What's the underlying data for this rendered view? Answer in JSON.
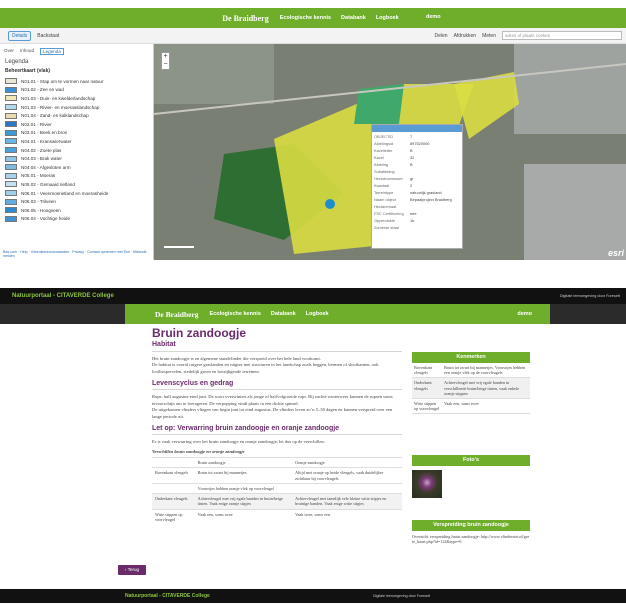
{
  "nav": {
    "brand": "De Braidberg",
    "items": [
      "Ecologische kennis",
      "Databank",
      "Logboek"
    ],
    "user": "demo"
  },
  "toolbar": {
    "details": "Details",
    "backstaat": "Backstaat",
    "right": [
      "Delen",
      "Afdrukken",
      "Meten"
    ],
    "search_placeholder": "adres of plaats zoeken"
  },
  "legend": {
    "tabs": [
      "Over",
      "Inhoud",
      "Legenda"
    ],
    "title": "Legenda",
    "subtitle": "Beheertkaart (vlak)",
    "items": [
      {
        "label": "N01.01 - Stap om te vormen naar natuur",
        "color": "#e9e7d4"
      },
      {
        "label": "N01.02 - Zee en wad",
        "color": "#3b8ed8"
      },
      {
        "label": "N01.03 - Duin- en kwelderlandschap",
        "color": "#f0e6b6"
      },
      {
        "label": "N01.03 - Rivier- en moerasslandschap",
        "color": "#b2d7ef"
      },
      {
        "label": "N01.04 - Zand- en kalklandschap",
        "color": "#e8dbb0"
      },
      {
        "label": "N02.01 - Rivier",
        "color": "#2c78c8"
      },
      {
        "label": "N03.01 - Beek en bron",
        "color": "#3a9ad8"
      },
      {
        "label": "N04.01 - Kranswierwater",
        "color": "#69b6e2"
      },
      {
        "label": "N04.02 - Zoete plas",
        "color": "#4aa2dc"
      },
      {
        "label": "N04.03 - Brak water",
        "color": "#8fc4e6"
      },
      {
        "label": "N04.04 - Afgesloten arm",
        "color": "#7cb9e0"
      },
      {
        "label": "N05.01 - Moeras",
        "color": "#a8d2ee"
      },
      {
        "label": "N05.02 - Gemaaid rietland",
        "color": "#c4e0f2"
      },
      {
        "label": "N06.01 - Veenmosrietland en moerasheide",
        "color": "#9ecfe9"
      },
      {
        "label": "N06.03 - Trilveen",
        "color": "#5fb0e0"
      },
      {
        "label": "N06.05 - Hoogveen",
        "color": "#2b8bcf"
      },
      {
        "label": "N06.04 - Vochtige heide",
        "color": "#3f92d2"
      }
    ],
    "footer": "Bas.com · Help · Gebruikersvoorwaarden · Privacy · Contact opnemen met Esri · Misbruik melden"
  },
  "map": {
    "popup": [
      [
        "OBJECTID",
        "7"
      ],
      [
        "Afdelingsid",
        "897520000"
      ],
      [
        "Kavelletter",
        "B"
      ],
      [
        "Kavel",
        "32"
      ],
      [
        "Afdeling",
        "B"
      ],
      [
        "Subafdeling",
        ""
      ],
      [
        "Hectoboomsoort",
        "gr"
      ],
      [
        "Kwartaal",
        "2"
      ],
      [
        "Terreintype",
        "natuurlijk grasland"
      ],
      [
        "Naam object",
        "Bepaalproject Braidberg"
      ],
      [
        "Hectaremaat",
        ""
      ],
      [
        "FSC Certificering",
        "nee"
      ],
      [
        "Oppervlakte",
        "1b"
      ],
      [
        "Zomerse staat",
        ""
      ]
    ],
    "attribution": "esri"
  },
  "page": {
    "header_title": "Natuurportaal - CITAVERDE College",
    "header_right": "Digitale leeromgeving door Foresett",
    "title": "Bruin zandoogje",
    "h_habitat": "Habitat",
    "habitat_1": "Het bruin zandoogje is en algemene standvlinder die verspreid over het hele land voorkomt.",
    "habitat_2": "De habitat is vooral ruigere graslanden en ruigtes met structuren in het landschap zoals heggen, bermen of slootkanten, ook loofbospercelen, stedelijk groen en bosrijkgende terreinen.",
    "h_cycle": "Levenscyclus en gedrag",
    "cycle_1": "Rups: half augustus-eind juni. De soort overwintert als jonge of halfvolgroeide rups. Bij zachte winterweer kunnen de rupsen soms tevoorschijn om te foerageren. De verpopping vindt plaats in een dichte spinsel.",
    "cycle_2": "De uitgekomen vlinders vliegen van begin juni tot eind augustus. De vlinders leven zo’n 5–30 dagen en kunnen verspreid over een lange periode uit.",
    "h_confusion": "Let op: Verwarring bruin zandoogje en oranje zandoogje",
    "confusion_1": "Er is vaak verwarring over het bruin zandoogje en oranje zandoogje, let dus op de verschillen.",
    "confusion_sub": "Verschillen bruin zandoogje en oranje zandoogje",
    "table_head": [
      "",
      "Bruin zandoogje",
      "Oranje zandoogje"
    ],
    "table_rows": [
      [
        "Bovenkant vleugels",
        "Bruin tot zwart bij mannetjes.",
        "Altijd met oranje op beide vleugels, vaak duidelijker zichtbaar bij voorvleugels"
      ],
      [
        "",
        "Vrouwtjes hebben oranje vlek op voorvleugel",
        ""
      ],
      [
        "Onderkant vleugels",
        "Achtervleugel met vrij egale banden in bruin/beige tinten. Vaak enige oranje stipjes",
        "Achtervleugel met tamelijk vele kleine witte stipjes en bruinige banden. Vaak enige witte stipjes"
      ],
      [
        "Witte stippen op voorvleugel",
        "Vaak een, soms twee",
        "Vaak twee, soms een"
      ]
    ],
    "side_kenmerken": "Kenmerken",
    "kenmerken_rows": [
      [
        "Bovenkant vleugels",
        "Bruin tot zwart bij mannetjes. Vrouwtjes hebben een oranje vlek op de voorvleugels"
      ],
      [
        "Onderkant vleugels",
        "Achtervleugel met vrij egale banden in verschillende bruin/beige tinten, vaak enkele oranje stippen"
      ],
      [
        "Witte stippen op voorvleugel",
        "Vaak een, soms twee"
      ]
    ],
    "side_fotos": "Foto’s",
    "side_verspreiding": "Verspreiding bruin zandoogje",
    "verspreiding_text": "Overzicht verspreiding bruin zandoogje: http://www.vlinderstet.nl/grete_kaart.php?id=124&type=6",
    "back_label": "Terug",
    "footer_title": "Natuurportaal - CITAVERDE College",
    "footer_right": "Digitale leeromgeving door Foresett"
  },
  "colors": {
    "green": "#6fae2a",
    "purple": "#6a2b6b",
    "dark": "#111111"
  }
}
